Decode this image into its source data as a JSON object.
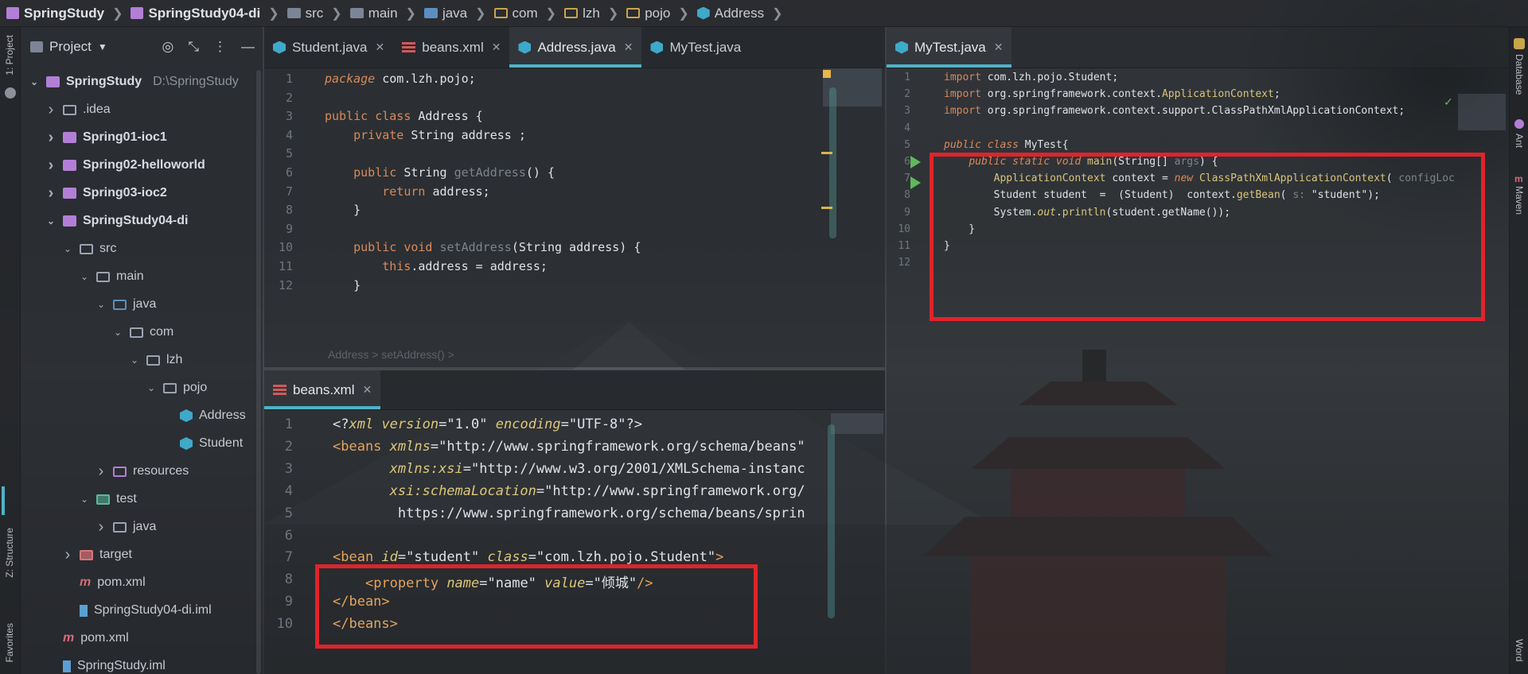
{
  "breadcrumb": [
    {
      "label": "SpringStudy",
      "icon": "module-icon",
      "bold": true
    },
    {
      "label": "SpringStudy04-di",
      "icon": "module-icon",
      "bold": true
    },
    {
      "label": "src",
      "icon": "source-folder-icon"
    },
    {
      "label": "main",
      "icon": "folder-icon"
    },
    {
      "label": "java",
      "icon": "folder-icon"
    },
    {
      "label": "com",
      "icon": "package-icon"
    },
    {
      "label": "lzh",
      "icon": "package-icon"
    },
    {
      "label": "pojo",
      "icon": "package-icon"
    },
    {
      "label": "Address",
      "icon": "class-icon"
    }
  ],
  "left_stripe": {
    "project": "1: Project",
    "structure": "Z: Structure",
    "favorites": "Favorites"
  },
  "right_stripe": {
    "database": "Database",
    "ant": "Ant",
    "maven": "Maven",
    "word": "Word"
  },
  "project_panel": {
    "title": "Project",
    "tree": [
      {
        "label": "SpringStudy",
        "extra": "D:\\SpringStudy",
        "level": 0,
        "arrow": "down",
        "bold": true,
        "icon": "module"
      },
      {
        "label": ".idea",
        "level": 1,
        "arrow": "right",
        "icon": "folder"
      },
      {
        "label": "Spring01-ioc1",
        "level": 1,
        "arrow": "right",
        "bold": true,
        "icon": "module"
      },
      {
        "label": "Spring02-helloworld",
        "level": 1,
        "arrow": "right",
        "bold": true,
        "icon": "module"
      },
      {
        "label": "Spring03-ioc2",
        "level": 1,
        "arrow": "right",
        "bold": true,
        "icon": "module"
      },
      {
        "label": "SpringStudy04-di",
        "level": 1,
        "arrow": "down",
        "bold": true,
        "icon": "module"
      },
      {
        "label": "src",
        "level": 2,
        "arrow": "down",
        "icon": "folder"
      },
      {
        "label": "main",
        "level": 3,
        "arrow": "down",
        "icon": "folder"
      },
      {
        "label": "java",
        "level": 4,
        "arrow": "down",
        "icon": "folder-src"
      },
      {
        "label": "com",
        "level": 5,
        "arrow": "down",
        "icon": "folder"
      },
      {
        "label": "lzh",
        "level": 6,
        "arrow": "down",
        "icon": "folder"
      },
      {
        "label": "pojo",
        "level": 7,
        "arrow": "down",
        "icon": "folder"
      },
      {
        "label": "Address",
        "level": 8,
        "arrow": "",
        "icon": "class"
      },
      {
        "label": "Student",
        "level": 8,
        "arrow": "",
        "icon": "class"
      },
      {
        "label": "resources",
        "level": 4,
        "arrow": "right",
        "icon": "folder-res"
      },
      {
        "label": "test",
        "level": 3,
        "arrow": "down",
        "icon": "folder-test"
      },
      {
        "label": "java",
        "level": 4,
        "arrow": "right",
        "icon": "folder"
      },
      {
        "label": "target",
        "level": 2,
        "arrow": "right",
        "icon": "folder-target"
      },
      {
        "label": "pom.xml",
        "level": 2,
        "arrow": "",
        "icon": "maven"
      },
      {
        "label": "SpringStudy04-di.iml",
        "level": 2,
        "arrow": "",
        "icon": "iml"
      },
      {
        "label": "pom.xml",
        "level": 1,
        "arrow": "",
        "icon": "maven"
      },
      {
        "label": "SpringStudy.iml",
        "level": 1,
        "arrow": "",
        "icon": "iml"
      }
    ]
  },
  "editor_left_tabs": [
    {
      "label": "Student.java",
      "type": "java",
      "active": false
    },
    {
      "label": "beans.xml",
      "type": "xml",
      "active": false
    },
    {
      "label": "Address.java",
      "type": "java",
      "active": true
    },
    {
      "label": "MyTest.java",
      "type": "java",
      "active": false
    }
  ],
  "address_code": {
    "line_numbers": [
      "1",
      "2",
      "3",
      "4",
      "5",
      "6",
      "7",
      "8",
      "9",
      "10",
      "11",
      "12"
    ],
    "lines": [
      [
        [
          "kwi",
          "package "
        ],
        [
          "str",
          "com.lzh.pojo;"
        ]
      ],
      [],
      [
        [
          "kw",
          "public class "
        ],
        [
          "str",
          "Address {"
        ]
      ],
      [
        [
          "str",
          "    "
        ],
        [
          "kw",
          "private "
        ],
        [
          "str",
          "String address ;"
        ]
      ],
      [],
      [
        [
          "str",
          "    "
        ],
        [
          "kw",
          "public "
        ],
        [
          "str",
          "String "
        ],
        [
          "gray",
          "getAddress"
        ],
        [
          "str",
          "() {"
        ]
      ],
      [
        [
          "str",
          "        "
        ],
        [
          "kw",
          "return "
        ],
        [
          "str",
          "address;"
        ]
      ],
      [
        [
          "str",
          "    }"
        ]
      ],
      [],
      [
        [
          "str",
          "    "
        ],
        [
          "kw",
          "public void "
        ],
        [
          "gray",
          "setAddress"
        ],
        [
          "str",
          "(String address) {"
        ]
      ],
      [
        [
          "str",
          "        "
        ],
        [
          "kw",
          "this"
        ],
        [
          "str",
          ".address = address;"
        ]
      ],
      [
        [
          "str",
          "    }"
        ]
      ]
    ],
    "breadcrumb_hint": "Address  >  setAddress()  >"
  },
  "beans_tab": {
    "label": "beans.xml"
  },
  "beans_code": {
    "line_numbers": [
      "1",
      "2",
      "3",
      "4",
      "5",
      "6",
      "7",
      "8",
      "9",
      "10"
    ],
    "lines": [
      [
        [
          "str",
          "<?"
        ],
        [
          "attr",
          "xml "
        ],
        [
          "attr",
          "version"
        ],
        [
          "str",
          "=\"1.0\" "
        ],
        [
          "attr",
          "encoding"
        ],
        [
          "str",
          "=\"UTF-8\"?>"
        ]
      ],
      [
        [
          "tag",
          "<beans "
        ],
        [
          "attr",
          "xmlns"
        ],
        [
          "str",
          "=\"http://www.springframework.org/schema/beans\""
        ]
      ],
      [
        [
          "str",
          "       "
        ],
        [
          "attr",
          "xmlns:xsi"
        ],
        [
          "str",
          "=\"http://www.w3.org/2001/XMLSchema-instanc"
        ]
      ],
      [
        [
          "str",
          "       "
        ],
        [
          "attr",
          "xsi:schemaLocation"
        ],
        [
          "str",
          "=\"http://www.springframework.org/"
        ]
      ],
      [
        [
          "str",
          "        https://www.springframework.org/schema/beans/sprin"
        ]
      ],
      [],
      [
        [
          "tag",
          "<bean "
        ],
        [
          "attr",
          "id"
        ],
        [
          "str",
          "=\"student\" "
        ],
        [
          "attr",
          "class"
        ],
        [
          "str",
          "=\"com.lzh.pojo.Student\""
        ],
        [
          "tag",
          ">"
        ]
      ],
      [
        [
          "str",
          "    "
        ],
        [
          "tag",
          "<property "
        ],
        [
          "attr",
          "name"
        ],
        [
          "str",
          "=\"name\" "
        ],
        [
          "attr",
          "value"
        ],
        [
          "str",
          "=\"倾城\""
        ],
        [
          "tag",
          "/>"
        ]
      ],
      [
        [
          "tag",
          "</bean>"
        ]
      ],
      [
        [
          "tag",
          "</beans>"
        ]
      ]
    ]
  },
  "mytest_tab": {
    "label": "MyTest.java"
  },
  "mytest_code": {
    "line_numbers": [
      "1",
      "2",
      "3",
      "4",
      "5",
      "6",
      "7",
      "8",
      "9",
      "10",
      "11",
      "12"
    ],
    "lines": [
      [
        [
          "kw",
          "import "
        ],
        [
          "str",
          "com.lzh.pojo.Student;"
        ]
      ],
      [
        [
          "kw",
          "import "
        ],
        [
          "str",
          "org.springframework.context."
        ],
        [
          "fn",
          "ApplicationContext"
        ],
        [
          "str",
          ";"
        ]
      ],
      [
        [
          "kw",
          "import "
        ],
        [
          "str",
          "org.springframework.context.support.ClassPathXmlApplicationContext;"
        ]
      ],
      [],
      [
        [
          "kwi",
          "public class "
        ],
        [
          "str",
          "MyTest{"
        ]
      ],
      [
        [
          "str",
          "    "
        ],
        [
          "kwi",
          "public static void "
        ],
        [
          "fn",
          "main"
        ],
        [
          "str",
          "(String[] "
        ],
        [
          "gray",
          "args"
        ],
        [
          "str",
          ") {"
        ]
      ],
      [
        [
          "str",
          "        "
        ],
        [
          "fn",
          "ApplicationContext "
        ],
        [
          "str",
          "context = "
        ],
        [
          "kwi",
          "new "
        ],
        [
          "fn",
          "ClassPathXmlApplicationContext"
        ],
        [
          "str",
          "( "
        ],
        [
          "gray",
          "configLoc"
        ]
      ],
      [
        [
          "str",
          "        Student student  =  (Student)  context."
        ],
        [
          "fn",
          "getBean"
        ],
        [
          "str",
          "( "
        ],
        [
          "gray",
          "s: "
        ],
        [
          "str",
          "\"student\");"
        ]
      ],
      [
        [
          "str",
          "        System."
        ],
        [
          "attr",
          "out"
        ],
        [
          "str",
          "."
        ],
        [
          "fn",
          "println"
        ],
        [
          "str",
          "(student.getName());"
        ]
      ],
      [
        [
          "str",
          "    }"
        ]
      ],
      [
        [
          "str",
          "}"
        ]
      ],
      []
    ]
  },
  "colors": {
    "highlight_box": "#e0232b",
    "active_tab_underline": "#4fb3c8",
    "run_icon": "#5fb85b"
  }
}
